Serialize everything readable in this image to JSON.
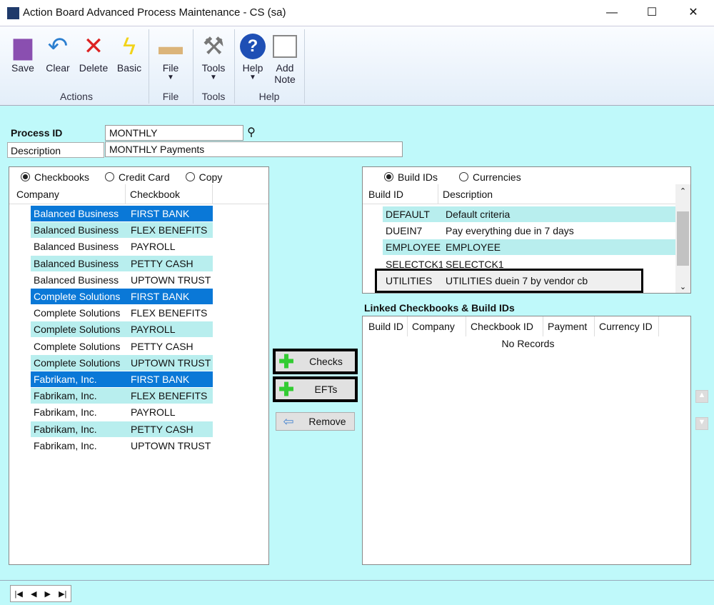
{
  "window": {
    "title": "Action Board Advanced Process Maintenance  -  CS (sa)",
    "min": "—",
    "max": "☐",
    "close": "✕"
  },
  "ribbon": {
    "buttons": [
      {
        "label": "Save"
      },
      {
        "label": "Clear"
      },
      {
        "label": "Delete"
      },
      {
        "label": "Basic"
      },
      {
        "label": "File"
      },
      {
        "label": "Tools"
      },
      {
        "label": "Help"
      },
      {
        "label": "Add",
        "label2": "Note"
      }
    ],
    "groups": [
      "Actions",
      "File",
      "Tools",
      "Help"
    ]
  },
  "form": {
    "process_id_label": "Process ID",
    "process_id": "MONTHLY",
    "description_label": "Description",
    "description": "MONTHLY Payments"
  },
  "left": {
    "radios": [
      "Checkbooks",
      "Credit Card",
      "Copy"
    ],
    "columns": [
      "Company",
      "Checkbook"
    ],
    "rows": [
      [
        "Balanced Business",
        "FIRST BANK",
        "sel"
      ],
      [
        "Balanced Business",
        "FLEX BENEFITS",
        "alt"
      ],
      [
        "Balanced Business",
        "PAYROLL",
        ""
      ],
      [
        "Balanced Business",
        "PETTY CASH",
        "alt"
      ],
      [
        "Balanced Business",
        "UPTOWN TRUST",
        ""
      ],
      [
        "Complete Solutions",
        "FIRST BANK",
        "sel"
      ],
      [
        "Complete Solutions",
        "FLEX BENEFITS",
        ""
      ],
      [
        "Complete Solutions",
        "PAYROLL",
        "alt"
      ],
      [
        "Complete Solutions",
        "PETTY CASH",
        ""
      ],
      [
        "Complete Solutions",
        "UPTOWN TRUST",
        "alt"
      ],
      [
        "Fabrikam, Inc.",
        "FIRST BANK",
        "sel"
      ],
      [
        "Fabrikam, Inc.",
        "FLEX BENEFITS",
        "alt"
      ],
      [
        "Fabrikam, Inc.",
        "PAYROLL",
        ""
      ],
      [
        "Fabrikam, Inc.",
        "PETTY CASH",
        "alt"
      ],
      [
        "Fabrikam, Inc.",
        "UPTOWN TRUST",
        ""
      ]
    ]
  },
  "buttons": {
    "checks": "Checks",
    "efts": "EFTs",
    "remove": "Remove"
  },
  "builds": {
    "radios": [
      "Build IDs",
      "Currencies"
    ],
    "columns": [
      "Build ID",
      "Description"
    ],
    "rows": [
      [
        "DEFAULT",
        "Default criteria",
        "alt"
      ],
      [
        "DUEIN7",
        "Pay everything due in 7 days",
        ""
      ],
      [
        "EMPLOYEE",
        "EMPLOYEE",
        "alt"
      ],
      [
        "SELECTCK1",
        "SELECTCK1",
        ""
      ],
      [
        "UTILITIES",
        "UTILITIES duein 7 by vendor cb",
        "focus"
      ]
    ]
  },
  "linked": {
    "title": "Linked Checkbooks & Build IDs",
    "columns": [
      "Build ID",
      "Company",
      "Checkbook  ID",
      "Payment",
      "Currency ID"
    ],
    "empty": "No Records"
  },
  "nav": [
    "|◀",
    "◀",
    "▶",
    "▶|"
  ]
}
